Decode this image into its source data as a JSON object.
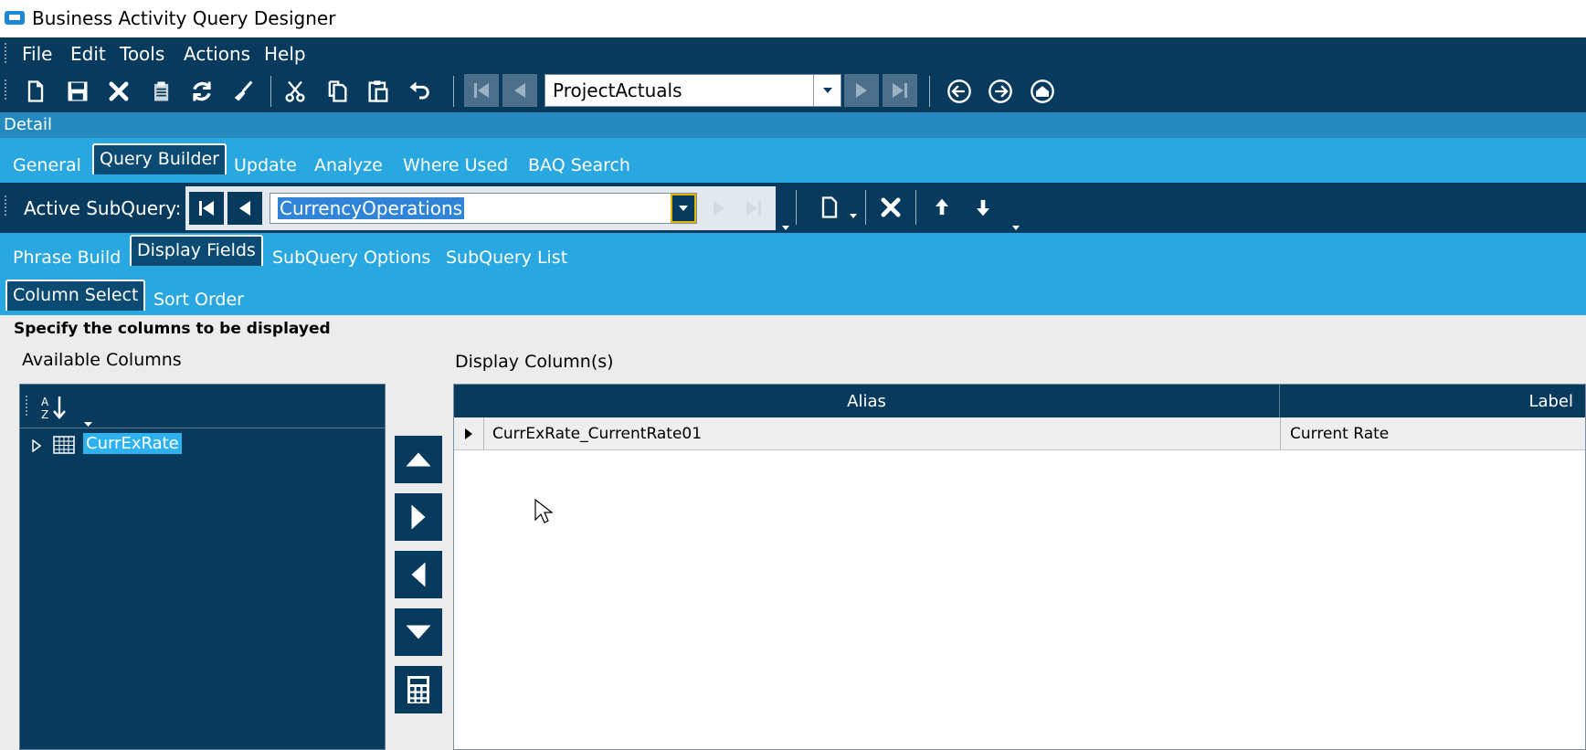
{
  "window": {
    "title": "Business Activity Query Designer"
  },
  "menu": {
    "items": [
      "File",
      "Edit",
      "Tools",
      "Actions",
      "Help"
    ]
  },
  "toolbar": {
    "query_combo_value": "ProjectActuals",
    "icons": [
      "new-icon",
      "save-icon",
      "delete-icon",
      "clipboard-icon",
      "refresh-icon",
      "clear-icon",
      "cut-icon",
      "copy-icon",
      "paste-icon",
      "undo-icon",
      "first-record-icon",
      "previous-record-icon",
      "next-record-icon",
      "last-record-icon",
      "back-icon",
      "forward-icon",
      "home-icon"
    ]
  },
  "detail": {
    "label": "Detail"
  },
  "main_tabs": [
    "General",
    "Query Builder",
    "Update",
    "Analyze",
    "Where Used",
    "BAQ Search"
  ],
  "main_tabs_active": "Query Builder",
  "subquery": {
    "label": "Active SubQuery:",
    "value": "CurrencyOperations"
  },
  "sub_tabs": [
    "Phrase Build",
    "Display Fields",
    "SubQuery Options",
    "SubQuery List"
  ],
  "sub_tabs_active": "Display Fields",
  "inner_tabs": [
    "Column Select",
    "Sort Order"
  ],
  "inner_tabs_active": "Column Select",
  "content": {
    "instruction": "Specify the columns to be displayed",
    "available_title": "Available Columns",
    "display_title": "Display Column(s)",
    "tree": [
      {
        "label": "CurrExRate"
      }
    ],
    "grid": {
      "columns": [
        "Alias",
        "Label"
      ],
      "rows": [
        {
          "alias": "CurrExRate_CurrentRate01",
          "label": "Current Rate"
        }
      ]
    }
  },
  "colors": {
    "dark_navy": "#073a5c",
    "tab_blue": "#29a7e1",
    "detail_blue": "#2489be",
    "selection": "#2db2ef"
  }
}
